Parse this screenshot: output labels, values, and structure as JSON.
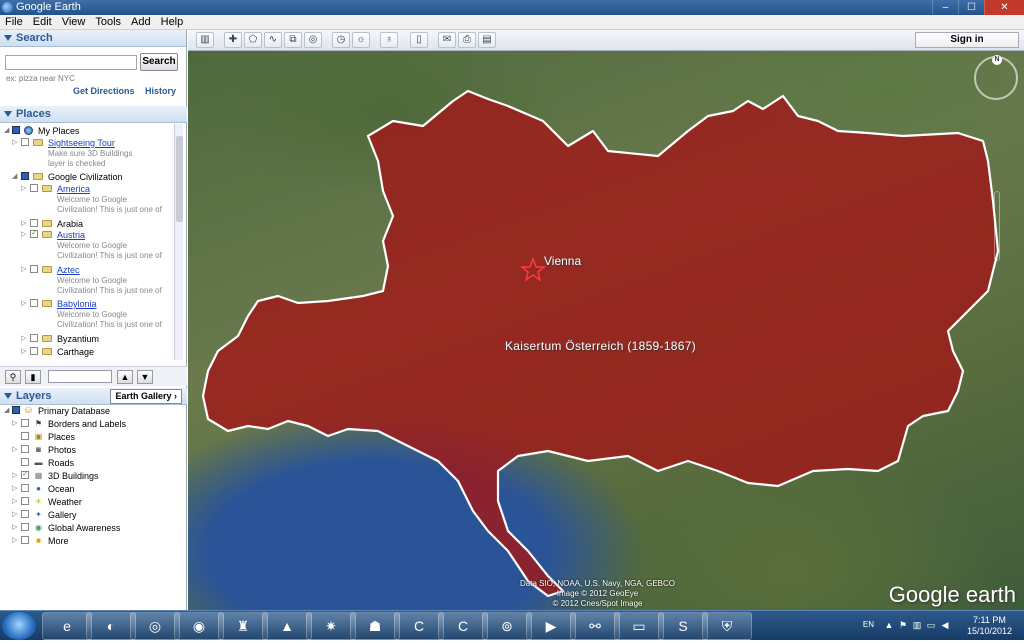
{
  "window": {
    "title": "Google Earth"
  },
  "menu": [
    "File",
    "Edit",
    "View",
    "Tools",
    "Add",
    "Help"
  ],
  "search": {
    "header": "Search",
    "button": "Search",
    "hint": "ex: pizza near NYC",
    "get_directions": "Get Directions",
    "history": "History"
  },
  "places": {
    "header": "Places",
    "items": [
      {
        "label": "My Places"
      },
      {
        "label": "Sightseeing Tour",
        "desc1": "Make sure 3D Buildings",
        "desc2": "layer is checked"
      },
      {
        "label": "Google Civilization"
      },
      {
        "label": "America",
        "desc1": "Welcome to Google",
        "desc2": "Civilization! This is just one of"
      },
      {
        "label": "Arabia"
      },
      {
        "label": "Austria",
        "desc1": "Welcome to Google",
        "desc2": "Civilization! This is just one of"
      },
      {
        "label": "Aztec",
        "desc1": "Welcome to Google",
        "desc2": "Civilization! This is just one of"
      },
      {
        "label": "Babylonia",
        "desc1": "Welcome to Google",
        "desc2": "Civilization! This is just one of"
      },
      {
        "label": "Byzantium"
      },
      {
        "label": "Carthage"
      }
    ]
  },
  "layers": {
    "header": "Layers",
    "gallery_button": "Earth Gallery",
    "items": [
      {
        "label": "Primary Database"
      },
      {
        "label": "Borders and Labels"
      },
      {
        "label": "Places"
      },
      {
        "label": "Photos"
      },
      {
        "label": "Roads"
      },
      {
        "label": "3D Buildings"
      },
      {
        "label": "Ocean"
      },
      {
        "label": "Weather"
      },
      {
        "label": "Gallery"
      },
      {
        "label": "Global Awareness"
      },
      {
        "label": "More"
      }
    ]
  },
  "toolbar": {
    "sign_in": "Sign in"
  },
  "map": {
    "city_label": "Vienna",
    "region_label": "Kaisertum Österreich (1859-1867)",
    "copyright1": "Data SIO, NOAA, U.S. Navy, NGA, GEBCO",
    "copyright2": "Image © 2012 GeoEye",
    "copyright3": "© 2012 Cnes/Spot Image",
    "logo": "Google earth",
    "compass_n": "N",
    "overlay_color": "#a01818"
  },
  "taskbar": {
    "lang": "EN",
    "time": "7:11 PM",
    "date": "15/10/2012"
  }
}
